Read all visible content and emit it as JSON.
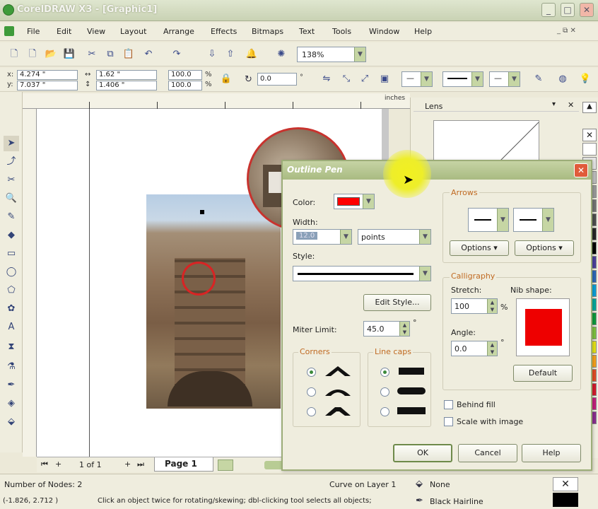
{
  "window": {
    "title": "CorelDRAW X3 - [Graphic1]"
  },
  "menu": [
    "File",
    "Edit",
    "View",
    "Layout",
    "Arrange",
    "Effects",
    "Bitmaps",
    "Text",
    "Tools",
    "Window",
    "Help"
  ],
  "toolbar": {
    "zoom": "138%"
  },
  "propbar": {
    "x": "4.274 \"",
    "y": "7.037 \"",
    "w": "1.62 \"",
    "h": "1.406 \"",
    "scale_x": "100.0",
    "scale_y": "100.0",
    "angle": "0.0",
    "x_label": "x:",
    "y_label": "y:",
    "pct": "%",
    "deg": "°"
  },
  "ruler": {
    "units": "inches"
  },
  "docker": {
    "title": "Lens"
  },
  "page_tabs": {
    "counter": "1 of 1",
    "tab": "Page 1"
  },
  "status": {
    "nodes": "Number of Nodes: 2",
    "layer": "Curve on Layer 1",
    "coords": "(-1.826, 2.712 )",
    "hint": "Click an object twice for rotating/skewing; dbl-clicking tool selects all objects;",
    "fill": "None",
    "outline": "Black Hairline"
  },
  "dialog": {
    "title": "Outline Pen",
    "color_label": "Color:",
    "color_value": "#ff0000",
    "width_label": "Width:",
    "width_value": "12.0",
    "width_units": "points",
    "style_label": "Style:",
    "edit_style": "Edit Style...",
    "miter_label": "Miter Limit:",
    "miter_value": "45.0",
    "miter_deg": "°",
    "corners_title": "Corners",
    "linecaps_title": "Line caps",
    "arrows_title": "Arrows",
    "options1": "Options",
    "options2": "Options",
    "calligraphy_title": "Calligraphy",
    "stretch_label": "Stretch:",
    "stretch_value": "100",
    "stretch_pct": "%",
    "nib_label": "Nib shape:",
    "angle_label": "Angle:",
    "angle_value": "0.0",
    "angle_deg": "°",
    "default_btn": "Default",
    "behind_fill": "Behind fill",
    "scale_image": "Scale with image",
    "ok": "OK",
    "cancel": "Cancel",
    "help": "Help",
    "nib_color": "#ee0000"
  },
  "palette_colors": [
    "#ffffff",
    "#e6e6e6",
    "#bfbfbf",
    "#999999",
    "#737373",
    "#4d4d4d",
    "#262626",
    "#000000",
    "#4b3f9c",
    "#2d67b8",
    "#0aa0d8",
    "#00a89c",
    "#0c9a3c",
    "#7ec23f",
    "#e5e216",
    "#f7a11a",
    "#e24c25",
    "#d41a2c",
    "#c21f7c",
    "#8a2d8f"
  ]
}
